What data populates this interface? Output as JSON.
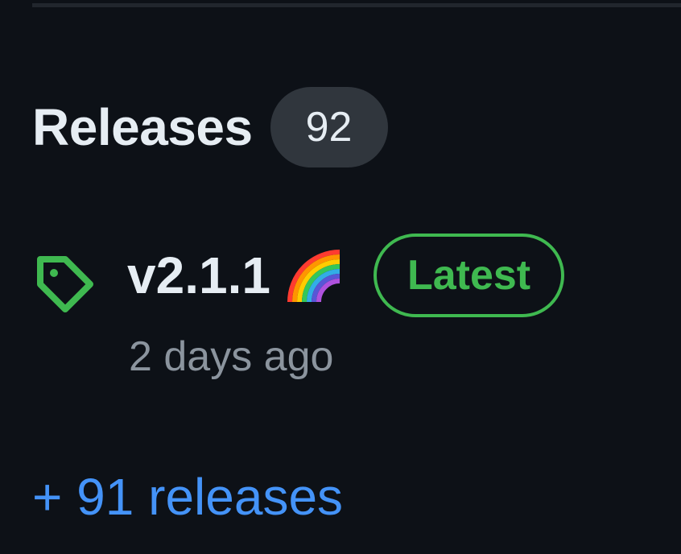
{
  "releases": {
    "title": "Releases",
    "count": "92"
  },
  "latest_release": {
    "version": "v2.1.1",
    "emoji_icon": "rainbow-icon",
    "badge": "Latest",
    "date": "2 days ago"
  },
  "more_link": {
    "text": "+ 91 releases"
  },
  "colors": {
    "background": "#0d1117",
    "text_primary": "#e6edf3",
    "text_muted": "#8b949e",
    "badge_bg": "#30363d",
    "success": "#3fb950",
    "link": "#4493f8"
  },
  "icons": {
    "tag": "tag-icon",
    "emoji": "rainbow-icon"
  }
}
